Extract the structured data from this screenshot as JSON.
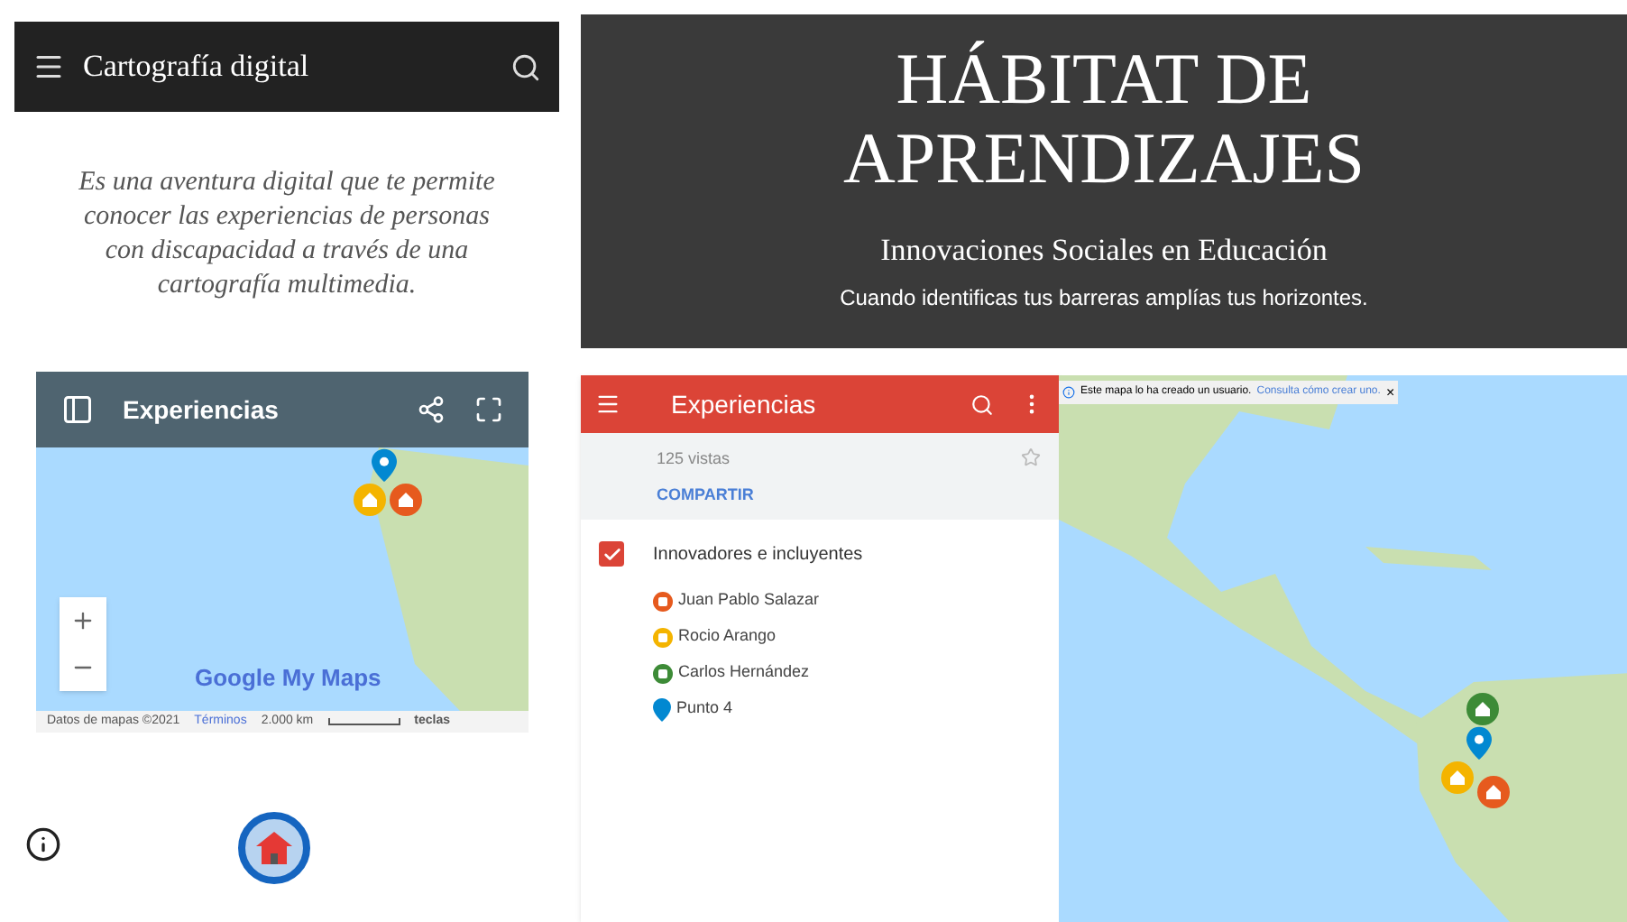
{
  "left_page": {
    "title": "Cartografía digital",
    "description": "Es una aventura digital que te permite conocer las experiencias de personas con discapacidad a través de una cartografía multimedia.",
    "embedded_map": {
      "title": "Experiencias",
      "logo": "Google My Maps",
      "attribution": "Datos de mapas ©2021",
      "terms_link": "Términos",
      "scale": "2.000 km",
      "keys_link": "teclas"
    }
  },
  "hero": {
    "title_lines": [
      "HÁBITAT DE",
      "APRENDIZAJES"
    ],
    "subtitle": "Innovaciones Sociales en Educación",
    "tagline": "Cuando identificas tus barreras amplías tus horizontes."
  },
  "map_panel": {
    "title": "Experiencias",
    "views": "125 vistas",
    "share_link": "COMPARTIR",
    "layer": {
      "name": "Innovadores e incluyentes",
      "checked": true,
      "items": [
        {
          "name": "Juan Pablo Salazar",
          "kind": "circle",
          "color": "#e65a1e"
        },
        {
          "name": "Rocio Arango",
          "kind": "circle",
          "color": "#f4b400"
        },
        {
          "name": "Carlos Hernández",
          "kind": "circle",
          "color": "#3d8b37"
        },
        {
          "name": "Punto 4",
          "kind": "pin",
          "color": "#0288d1"
        }
      ]
    }
  },
  "map_notice": {
    "text": "Este mapa lo ha creado un usuario.",
    "link": "Consulta cómo crear uno.",
    "close": "×"
  }
}
